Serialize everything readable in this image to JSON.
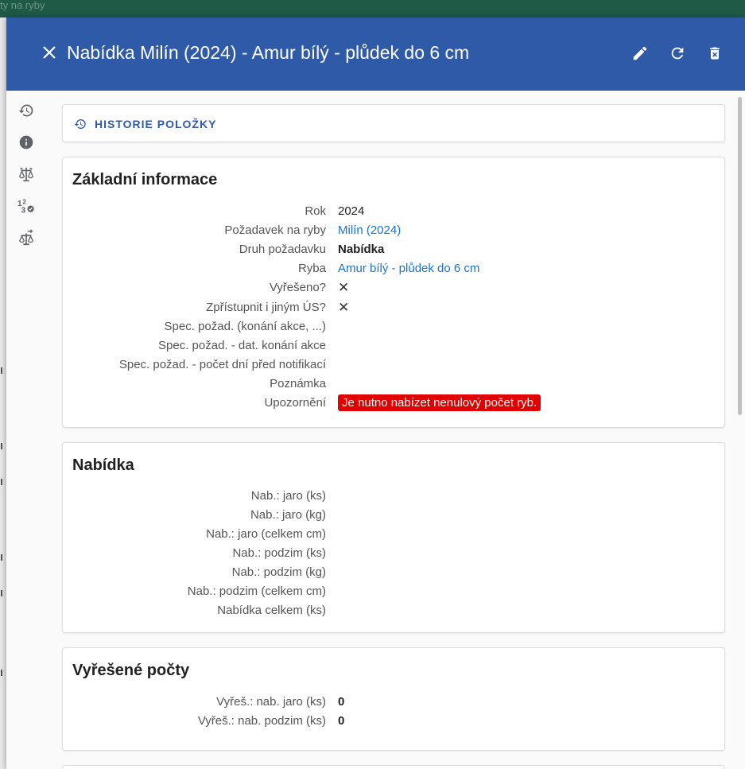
{
  "background": {
    "partial_text": "ty na ryby"
  },
  "header": {
    "title": "Nabídka Milín (2024) - Amur bílý - plůdek do 6 cm",
    "icons": [
      "close-icon",
      "edit-icon",
      "refresh-icon",
      "delete-icon"
    ],
    "color": "#2f5aa8"
  },
  "rail": {
    "icons": [
      "history-icon",
      "info-icon",
      "scale-icon",
      "counter-icon",
      "scale-arrow-icon"
    ]
  },
  "history": {
    "label": "HISTORIE POLOŽKY"
  },
  "basic": {
    "title": "Základní informace",
    "rows": [
      {
        "label": "Rok",
        "value": "2024"
      },
      {
        "label": "Požadavek na ryby",
        "value": "Milín (2024)"
      },
      {
        "label": "Druh požadavku",
        "value": "Nabídka"
      },
      {
        "label": "Ryba",
        "value": "Amur bílý - plůdek do 6 cm"
      },
      {
        "label": "Vyřešeno?",
        "value": "✕"
      },
      {
        "label": "Zpřístupnit i jiným ÚS?",
        "value": "✕"
      },
      {
        "label": "Spec. požad. (konání akce, ...)",
        "value": ""
      },
      {
        "label": "Spec. požad. - dat. konání akce",
        "value": ""
      },
      {
        "label": "Spec. požad. - počet dní před notifikací",
        "value": ""
      },
      {
        "label": "Poznámka",
        "value": ""
      },
      {
        "label": "Upozornění",
        "value": "Je nutno nabízet nenulový počet ryb."
      }
    ]
  },
  "offer": {
    "title": "Nabídka",
    "rows": [
      {
        "label": "Nab.: jaro (ks)"
      },
      {
        "label": "Nab.: jaro (kg)"
      },
      {
        "label": "Nab.: jaro (celkem cm)"
      },
      {
        "label": "Nab.: podzim (ks)"
      },
      {
        "label": "Nab.: podzim (kg)"
      },
      {
        "label": "Nab.: podzim (celkem cm)"
      },
      {
        "label": "Nabídka celkem (ks)"
      }
    ]
  },
  "resolved": {
    "title": "Vyřešené počty",
    "rows": [
      {
        "label": "Vyřeš.: nab. jaro (ks)",
        "value": "0"
      },
      {
        "label": "Vyřeš.: nab. podzim (ks)",
        "value": "0"
      }
    ]
  }
}
